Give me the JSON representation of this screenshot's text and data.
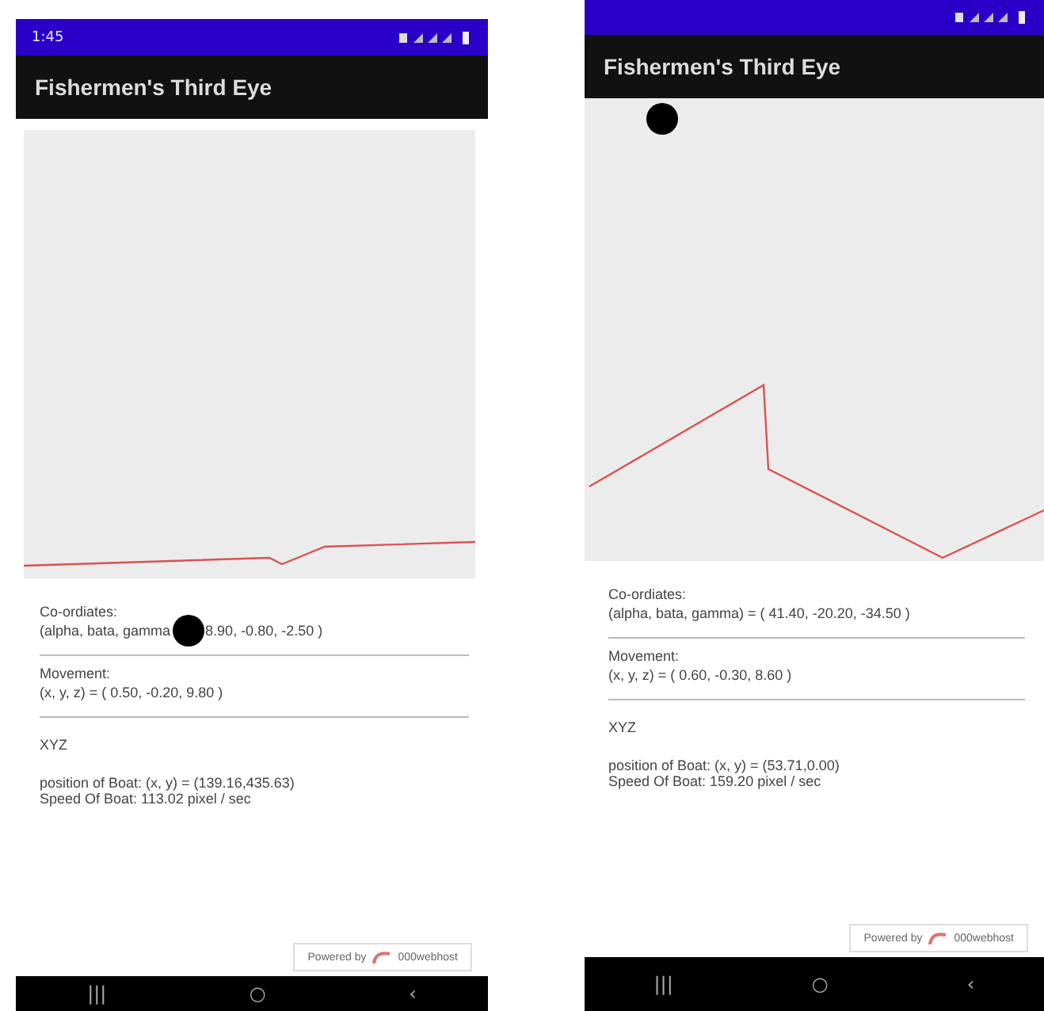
{
  "phones": [
    {
      "status_bar": {
        "time": "1:45"
      },
      "app_bar": {
        "title": "Fishermen's Third Eye"
      },
      "readings": [
        {
          "label": "Co-ordiates:",
          "value_before": "(alpha, bata, gamma",
          "value_after": "8.90, -0.80, -2.50 )"
        },
        {
          "label": "Movement:",
          "value_before": "(x, y, z) = ( 0.50, -0.20, 9.80 )"
        }
      ],
      "section": "XYZ",
      "position": "position of Boat: (x, y) = (139.16,435.63)",
      "speed": "Speed Of Boat: 113.02 pixel / sec",
      "powered_by": {
        "prefix": "Powered by",
        "brand": "000webhost"
      },
      "nav": [
        "|||",
        "○",
        "‹"
      ]
    },
    {
      "app_bar": {
        "title": "Fishermen's Third Eye"
      },
      "readings": [
        {
          "label": "Co-ordiates:",
          "value_before": "(alpha, bata, gamma) = ( 41.40, -20.20, -34.50 )"
        },
        {
          "label": "Movement:",
          "value_before": "(x, y, z) = ( 0.60, -0.30, 8.60 )"
        }
      ],
      "section": "XYZ",
      "position": "position of Boat: (x, y) = (53.71,0.00)",
      "speed": "Speed Of Boat: 159.20 pixel / sec",
      "powered_by": {
        "prefix": "Powered by",
        "brand": "000webhost"
      },
      "nav": [
        "|||",
        "○",
        "‹"
      ]
    }
  ]
}
